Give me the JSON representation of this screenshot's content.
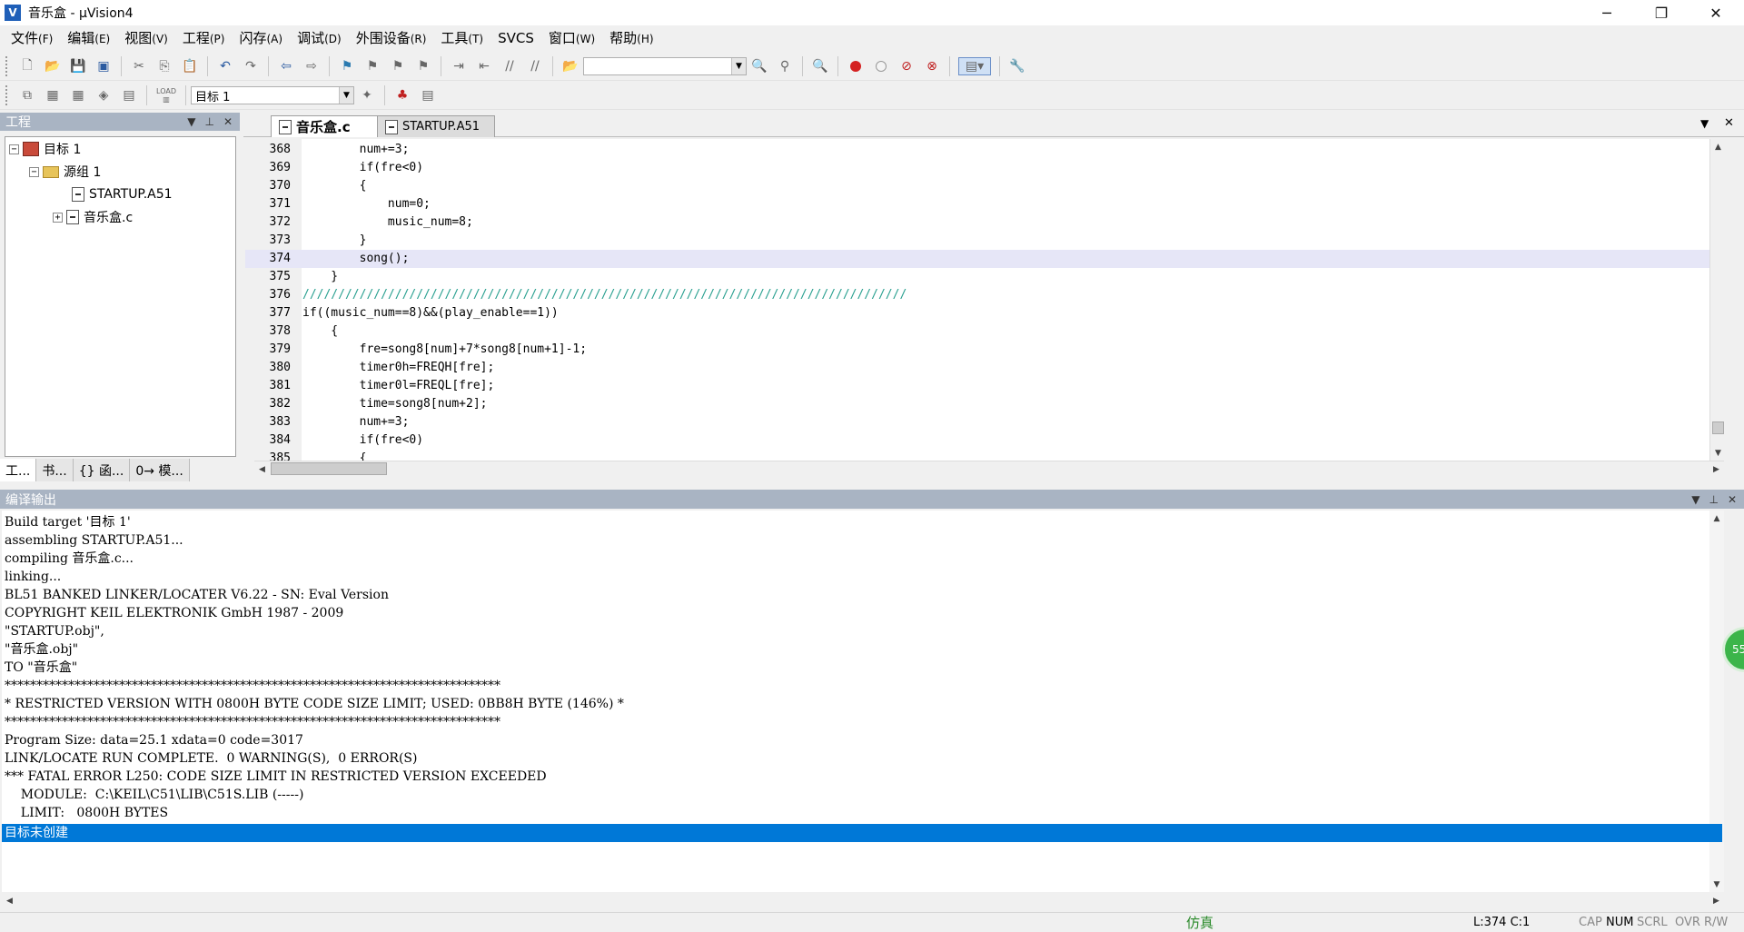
{
  "window": {
    "title": "音乐盒  - µVision4",
    "app_icon": "V"
  },
  "menu": [
    {
      "label": "文件",
      "acc": "(F)"
    },
    {
      "label": "编辑",
      "acc": "(E)"
    },
    {
      "label": "视图",
      "acc": "(V)"
    },
    {
      "label": "工程",
      "acc": "(P)"
    },
    {
      "label": "闪存",
      "acc": "(A)"
    },
    {
      "label": "调试",
      "acc": "(D)"
    },
    {
      "label": "外围设备",
      "acc": "(R)"
    },
    {
      "label": "工具",
      "acc": "(T)"
    },
    {
      "label": "SVCS",
      "acc": ""
    },
    {
      "label": "窗口",
      "acc": "(W)"
    },
    {
      "label": "帮助",
      "acc": "(H)"
    }
  ],
  "toolbar2": {
    "target_select": "目标 1",
    "load_label": "LOAD"
  },
  "project": {
    "title": "工程",
    "tree": {
      "target": "目标 1",
      "group": "源组 1",
      "files": [
        "STARTUP.A51",
        "音乐盒.c"
      ]
    },
    "tabs": [
      "工...",
      "书...",
      "{} 函...",
      "0→ 模..."
    ]
  },
  "editor": {
    "tabs": [
      "音乐盒.c",
      "STARTUP.A51"
    ],
    "current_line": 374,
    "lines": [
      {
        "n": "368",
        "t": "        num+=3;"
      },
      {
        "n": "369",
        "t": "        if(fre<0)"
      },
      {
        "n": "370",
        "t": "        {"
      },
      {
        "n": "371",
        "t": "            num=0;"
      },
      {
        "n": "372",
        "t": "            music_num=8;"
      },
      {
        "n": "373",
        "t": "        }"
      },
      {
        "n": "374",
        "t": "        song();"
      },
      {
        "n": "375",
        "t": "    }"
      },
      {
        "n": "376",
        "t": "/////////////////////////////////////////////////////////////////////////////////////"
      },
      {
        "n": "377",
        "t": "if((music_num==8)&&(play_enable==1))"
      },
      {
        "n": "378",
        "t": "    {"
      },
      {
        "n": "379",
        "t": "        fre=song8[num]+7*song8[num+1]-1;"
      },
      {
        "n": "380",
        "t": "        timer0h=FREQH[fre];"
      },
      {
        "n": "381",
        "t": "        timer0l=FREQL[fre];"
      },
      {
        "n": "382",
        "t": "        time=song8[num+2];"
      },
      {
        "n": "383",
        "t": "        num+=3;"
      },
      {
        "n": "384",
        "t": "        if(fre<0)"
      },
      {
        "n": "385",
        "t": "        {"
      }
    ]
  },
  "build": {
    "title": "编译输出",
    "lines": [
      "Build target '目标 1'",
      "assembling STARTUP.A51...",
      "compiling 音乐盒.c...",
      "linking...",
      "BL51 BANKED LINKER/LOCATER V6.22 - SN: Eval Version",
      "COPYRIGHT KEIL ELEKTRONIK GmbH 1987 - 2009",
      "\"STARTUP.obj\",",
      "\"音乐盒.obj\"",
      "TO \"音乐盒\"",
      "******************************************************************************",
      "* RESTRICTED VERSION WITH 0800H BYTE CODE SIZE LIMIT; USED: 0BB8H BYTE (146%) *",
      "******************************************************************************",
      "Program Size: data=25.1 xdata=0 code=3017",
      "LINK/LOCATE RUN COMPLETE.  0 WARNING(S),  0 ERROR(S)",
      "*** FATAL ERROR L250: CODE SIZE LIMIT IN RESTRICTED VERSION EXCEEDED",
      "    MODULE:  C:\\KEIL\\C51\\LIB\\C51S.LIB (-----)",
      "    LIMIT:   0800H BYTES"
    ],
    "selected_line": "目标未创建"
  },
  "status": {
    "mode": "仿真",
    "position": "L:374 C:1",
    "indicators": [
      "CAP",
      "NUM",
      "SCRL",
      "OVR",
      "R/W"
    ]
  },
  "badge": "55",
  "colors": {
    "selection": "#0078d7",
    "current_line": "#e6e6f7",
    "comment": "#2aa090",
    "panel_head": "#a9b4c3",
    "mode": "#2a8a2a"
  }
}
